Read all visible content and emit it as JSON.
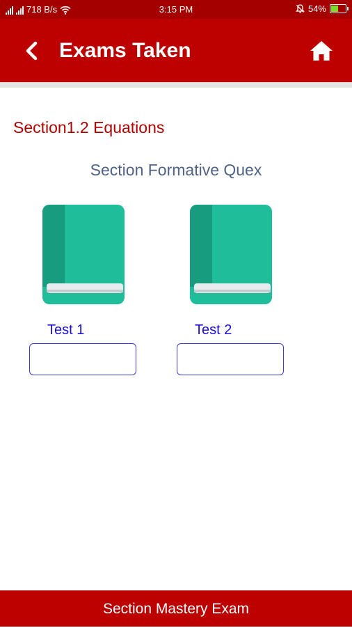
{
  "status_bar": {
    "network_speed": "718 B/s",
    "time": "3:15 PM",
    "battery_percent": "54%",
    "battery_level": 0.54,
    "icons": [
      "signal-icon",
      "wifi-icon",
      "alarm-icon",
      "battery-icon"
    ]
  },
  "header": {
    "title": "Exams Taken",
    "back_icon": "chevron-left-icon",
    "home_icon": "home-icon"
  },
  "content": {
    "section_title": "Section1.2 Equations",
    "quiz_label": "Section Formative Quex",
    "tests": [
      {
        "label": "Test 1",
        "value": ""
      },
      {
        "label": "Test 2",
        "value": ""
      }
    ]
  },
  "footer": {
    "button_label": "Section Mastery Exam"
  },
  "colors": {
    "header": "#bd0000",
    "status_bar": "#a40000",
    "section_title": "#b00000",
    "quiz_label": "#4f6385",
    "test_label": "#1a0ed6",
    "book_cover": "#1fbd9a",
    "book_spine": "#189c80"
  }
}
